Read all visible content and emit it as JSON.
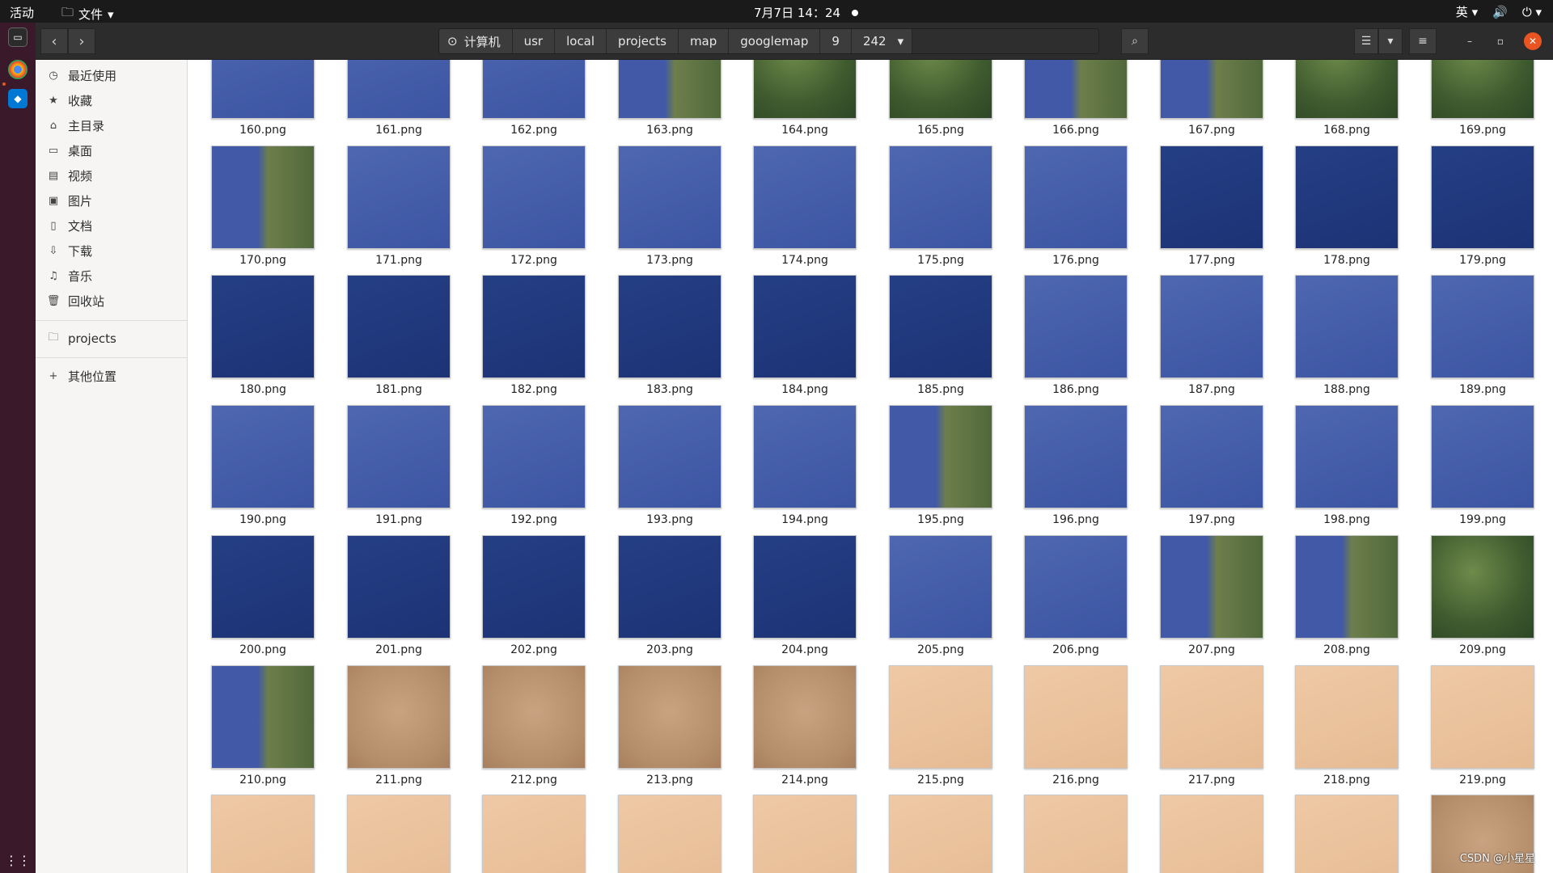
{
  "topbar": {
    "activities": "活动",
    "files_menu": "文件",
    "clock": "7月7日 14：24",
    "input_method": "英"
  },
  "header": {
    "breadcrumbs": [
      "计算机",
      "usr",
      "local",
      "projects",
      "map",
      "googlemap",
      "9",
      "242"
    ]
  },
  "sidebar": {
    "items": [
      {
        "label": "最近使用",
        "icon": "clock-icon"
      },
      {
        "label": "收藏",
        "icon": "star-icon"
      },
      {
        "label": "主目录",
        "icon": "home-icon"
      },
      {
        "label": "桌面",
        "icon": "desktop-icon"
      },
      {
        "label": "视频",
        "icon": "video-icon"
      },
      {
        "label": "图片",
        "icon": "image-icon"
      },
      {
        "label": "文档",
        "icon": "document-icon"
      },
      {
        "label": "下载",
        "icon": "download-icon"
      },
      {
        "label": "音乐",
        "icon": "music-icon"
      },
      {
        "label": "回收站",
        "icon": "trash-icon"
      }
    ],
    "bookmark": "projects",
    "other_locations": "其他位置"
  },
  "files": [
    {
      "name": "160.png",
      "kind": "ocean"
    },
    {
      "name": "161.png",
      "kind": "ocean"
    },
    {
      "name": "162.png",
      "kind": "ocean"
    },
    {
      "name": "163.png",
      "kind": "coast"
    },
    {
      "name": "164.png",
      "kind": "land"
    },
    {
      "name": "165.png",
      "kind": "land"
    },
    {
      "name": "166.png",
      "kind": "coast"
    },
    {
      "name": "167.png",
      "kind": "coast"
    },
    {
      "name": "168.png",
      "kind": "land"
    },
    {
      "name": "169.png",
      "kind": "land"
    },
    {
      "name": "170.png",
      "kind": "coast"
    },
    {
      "name": "171.png",
      "kind": "ocean"
    },
    {
      "name": "172.png",
      "kind": "ocean"
    },
    {
      "name": "173.png",
      "kind": "ocean"
    },
    {
      "name": "174.png",
      "kind": "ocean"
    },
    {
      "name": "175.png",
      "kind": "ocean"
    },
    {
      "name": "176.png",
      "kind": "ocean"
    },
    {
      "name": "177.png",
      "kind": "deep"
    },
    {
      "name": "178.png",
      "kind": "deep"
    },
    {
      "name": "179.png",
      "kind": "deep"
    },
    {
      "name": "180.png",
      "kind": "deep"
    },
    {
      "name": "181.png",
      "kind": "deep"
    },
    {
      "name": "182.png",
      "kind": "deep"
    },
    {
      "name": "183.png",
      "kind": "deep"
    },
    {
      "name": "184.png",
      "kind": "deep"
    },
    {
      "name": "185.png",
      "kind": "deep"
    },
    {
      "name": "186.png",
      "kind": "ocean"
    },
    {
      "name": "187.png",
      "kind": "ocean"
    },
    {
      "name": "188.png",
      "kind": "ocean"
    },
    {
      "name": "189.png",
      "kind": "ocean"
    },
    {
      "name": "190.png",
      "kind": "ocean"
    },
    {
      "name": "191.png",
      "kind": "ocean"
    },
    {
      "name": "192.png",
      "kind": "ocean"
    },
    {
      "name": "193.png",
      "kind": "ocean"
    },
    {
      "name": "194.png",
      "kind": "ocean"
    },
    {
      "name": "195.png",
      "kind": "coast"
    },
    {
      "name": "196.png",
      "kind": "ocean"
    },
    {
      "name": "197.png",
      "kind": "ocean"
    },
    {
      "name": "198.png",
      "kind": "ocean"
    },
    {
      "name": "199.png",
      "kind": "ocean"
    },
    {
      "name": "200.png",
      "kind": "deep"
    },
    {
      "name": "201.png",
      "kind": "deep"
    },
    {
      "name": "202.png",
      "kind": "deep"
    },
    {
      "name": "203.png",
      "kind": "deep"
    },
    {
      "name": "204.png",
      "kind": "deep"
    },
    {
      "name": "205.png",
      "kind": "ocean"
    },
    {
      "name": "206.png",
      "kind": "ocean"
    },
    {
      "name": "207.png",
      "kind": "coast"
    },
    {
      "name": "208.png",
      "kind": "coast"
    },
    {
      "name": "209.png",
      "kind": "land"
    },
    {
      "name": "210.png",
      "kind": "coast"
    },
    {
      "name": "211.png",
      "kind": "desert"
    },
    {
      "name": "212.png",
      "kind": "desert"
    },
    {
      "name": "213.png",
      "kind": "desert"
    },
    {
      "name": "214.png",
      "kind": "desert"
    },
    {
      "name": "215.png",
      "kind": "sand"
    },
    {
      "name": "216.png",
      "kind": "sand"
    },
    {
      "name": "217.png",
      "kind": "sand"
    },
    {
      "name": "218.png",
      "kind": "sand"
    },
    {
      "name": "219.png",
      "kind": "sand"
    },
    {
      "name": "",
      "kind": "sand"
    },
    {
      "name": "",
      "kind": "sand"
    },
    {
      "name": "",
      "kind": "sand"
    },
    {
      "name": "",
      "kind": "sand"
    },
    {
      "name": "",
      "kind": "sand"
    },
    {
      "name": "",
      "kind": "sand"
    },
    {
      "name": "",
      "kind": "sand"
    },
    {
      "name": "",
      "kind": "sand"
    },
    {
      "name": "",
      "kind": "sand"
    },
    {
      "name": "",
      "kind": "desert"
    }
  ],
  "watermark": "CSDN @小星星",
  "colors": {
    "accent": "#e95420",
    "topbar": "#1a1a1a",
    "headerbar": "#2c2c2c",
    "sidebar": "#f6f5f4",
    "dock": "#3a1a2a"
  }
}
